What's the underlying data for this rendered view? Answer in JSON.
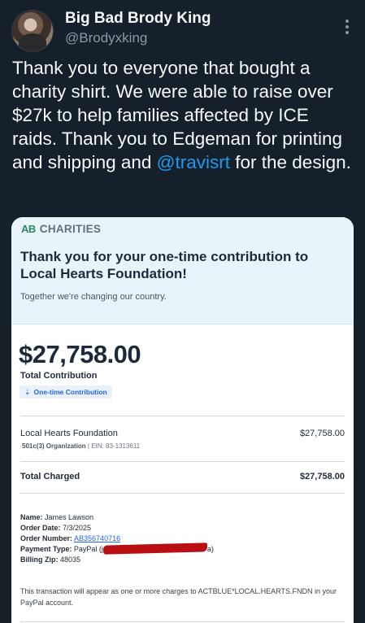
{
  "tweet": {
    "display_name": "Big Bad Brody King",
    "handle": "@Brodyxking",
    "text_part1": "Thank you to everyone that bought a charity shirt. We were able to raise over $27k to help families affected by ICE raids. Thank you to Edgeman for printing and shipping and ",
    "mention": "@travisrt",
    "text_part2": " for the design.",
    "icons": {
      "avatar": "avatar",
      "more": "more-vertical-icon"
    }
  },
  "receipt": {
    "brand_logo": "AB",
    "brand_name": "CHARITIES",
    "thanks": "Thank you for your one-time contribution to Local Hearts Foundation!",
    "subtitle": "Together we're changing our country.",
    "total_amount": "$27,758.00",
    "total_label": "Total Contribution",
    "pill_label": "One-time Contribution",
    "org_name": "Local Hearts Foundation",
    "org_amount": "$27,758.00",
    "org_type": "501c(3) Organization",
    "org_ein": "| EIN: 83-1313611",
    "total_charged_label": "Total Charged",
    "total_charged_amount": "$27,758.00",
    "name_label": "Name:",
    "name_value": "James Lawson",
    "date_label": "Order Date:",
    "date_value": "7/3/2025",
    "order_label": "Order Number:",
    "order_value": "AB356740716",
    "payment_label": "Payment Type:",
    "payment_value": "PayPal (j",
    "payment_suffix": "a)",
    "zip_label": "Billing Zip:",
    "zip_value": "48035",
    "note": "This transaction will appear as one or more charges to ACTBLUE*LOCAL.HEARTS.FNDN in your PayPal account.",
    "colors": {
      "accent": "#1d9bf0",
      "background": "#15202b",
      "brand_green": "#2c8a5a",
      "link": "#2563eb",
      "redaction": "#b90f12"
    }
  }
}
